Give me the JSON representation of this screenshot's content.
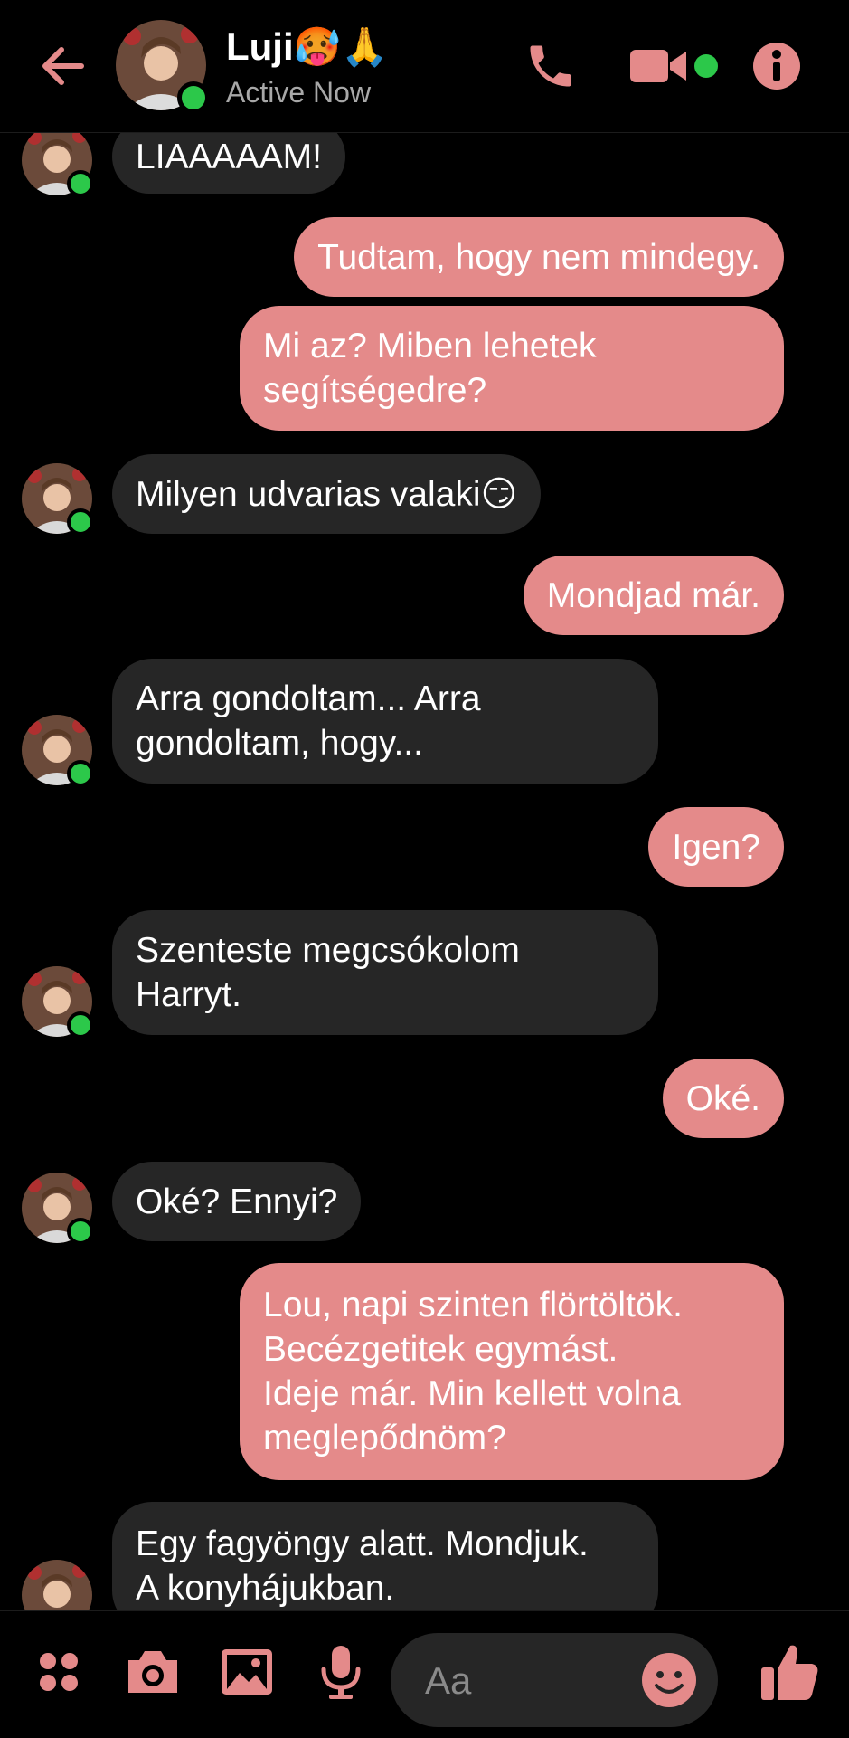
{
  "header": {
    "name": "Luji",
    "name_emojis": "🥵🙏",
    "status": "Active Now",
    "icons": [
      "back-arrow-icon",
      "phone-icon",
      "video-camera-icon",
      "info-icon"
    ]
  },
  "messages": [
    {
      "from": "them",
      "text": "LIAAAAAM!"
    },
    {
      "from": "me",
      "text": "Tudtam, hogy nem mindegy."
    },
    {
      "from": "me",
      "text": "Mi az? Miben lehetek\nsegítségedre?"
    },
    {
      "from": "them",
      "text": "Milyen udvarias valaki😏"
    },
    {
      "from": "me",
      "text": "Mondjad már."
    },
    {
      "from": "them",
      "text": "Arra gondoltam... Arra\ngondoltam, hogy..."
    },
    {
      "from": "me",
      "text": "Igen?"
    },
    {
      "from": "them",
      "text": "Szenteste megcsókolom\nHarryt."
    },
    {
      "from": "me",
      "text": "Oké."
    },
    {
      "from": "them",
      "text": "Oké? Ennyi?"
    },
    {
      "from": "me",
      "text": "Lou, napi szinten flörtöltök.\nBecézgetitek egymást.\nIdeje már. Min kellett volna\nmeglepődnöm?"
    },
    {
      "from": "them",
      "text": "Egy fagyöngy alatt. Mondjuk.\nA konyhájukban."
    }
  ],
  "composer": {
    "placeholder": "Aa",
    "icons": [
      "menu-dots-icon",
      "camera-icon",
      "image-icon",
      "microphone-icon",
      "emoji-icon",
      "thumbs-up-icon"
    ]
  },
  "colors": {
    "accent": "#e48a8a",
    "incoming_bubble": "#262626",
    "online": "#2cc84a",
    "background": "#000000"
  }
}
